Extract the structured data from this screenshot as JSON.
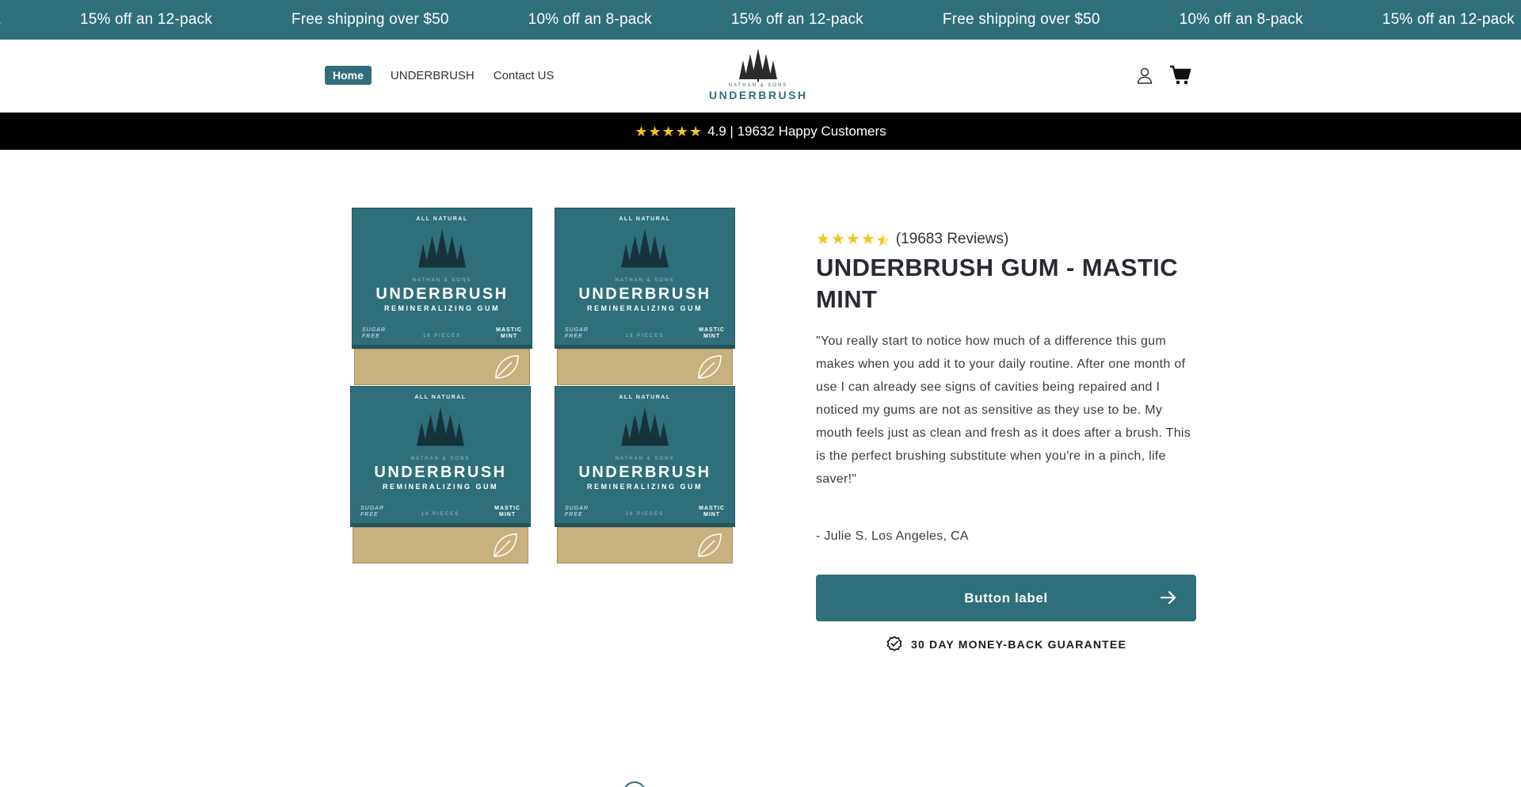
{
  "announcement": {
    "items": [
      "pack",
      "15% off an 12-pack",
      "Free shipping over $50",
      "10% off an 8-pack",
      "15% off an 12-pack",
      "Free shipping over $50",
      "10% off an 8-pack",
      "15% off an 12-pack"
    ]
  },
  "header": {
    "nav": [
      {
        "label": "Home",
        "active": true
      },
      {
        "label": "UNDERBRUSH",
        "active": false
      },
      {
        "label": "Contact US",
        "active": false
      }
    ],
    "logo": {
      "small": "NATHAN & SONS",
      "word": "UNDERBRUSH"
    },
    "icons": [
      "account-icon",
      "cart-icon"
    ]
  },
  "rating_bar": {
    "text": "4.9 | 19632 Happy Customers",
    "star_count": 5
  },
  "product": {
    "box": {
      "top": "ALL NATURAL",
      "sons": "NATHAN & SONS",
      "brand": "UNDERBRUSH",
      "sub": "REMINERALIZING GUM",
      "sugar_line1": "SUGAR",
      "sugar_line2": "FREE",
      "pieces": "18 PIECES",
      "flavor_line1": "MASTIC",
      "flavor_line2": "MINT"
    },
    "rating": 4.5,
    "review_count": "(19683 Reviews)",
    "title": "UNDERBRUSH GUM - MASTIC MINT",
    "quote": "\"You really start to notice how much of a difference this gum makes when you add it to your daily routine. After one month of use I can already see signs of cavities being repaired and I noticed my gums are not as sensitive as they use to be. My mouth feels just as clean and fresh as it does after a brush. This is the perfect brushing substitute when you're in a pinch, life saver!\"",
    "author": "- Julie S. Los Angeles, CA",
    "button_label": "Button label",
    "guarantee": "30 DAY MONEY-BACK GUARANTEE"
  },
  "colors": {
    "brand": "#2f6f7b",
    "star": "#f5c518",
    "rating_bar_bg": "#000000"
  }
}
